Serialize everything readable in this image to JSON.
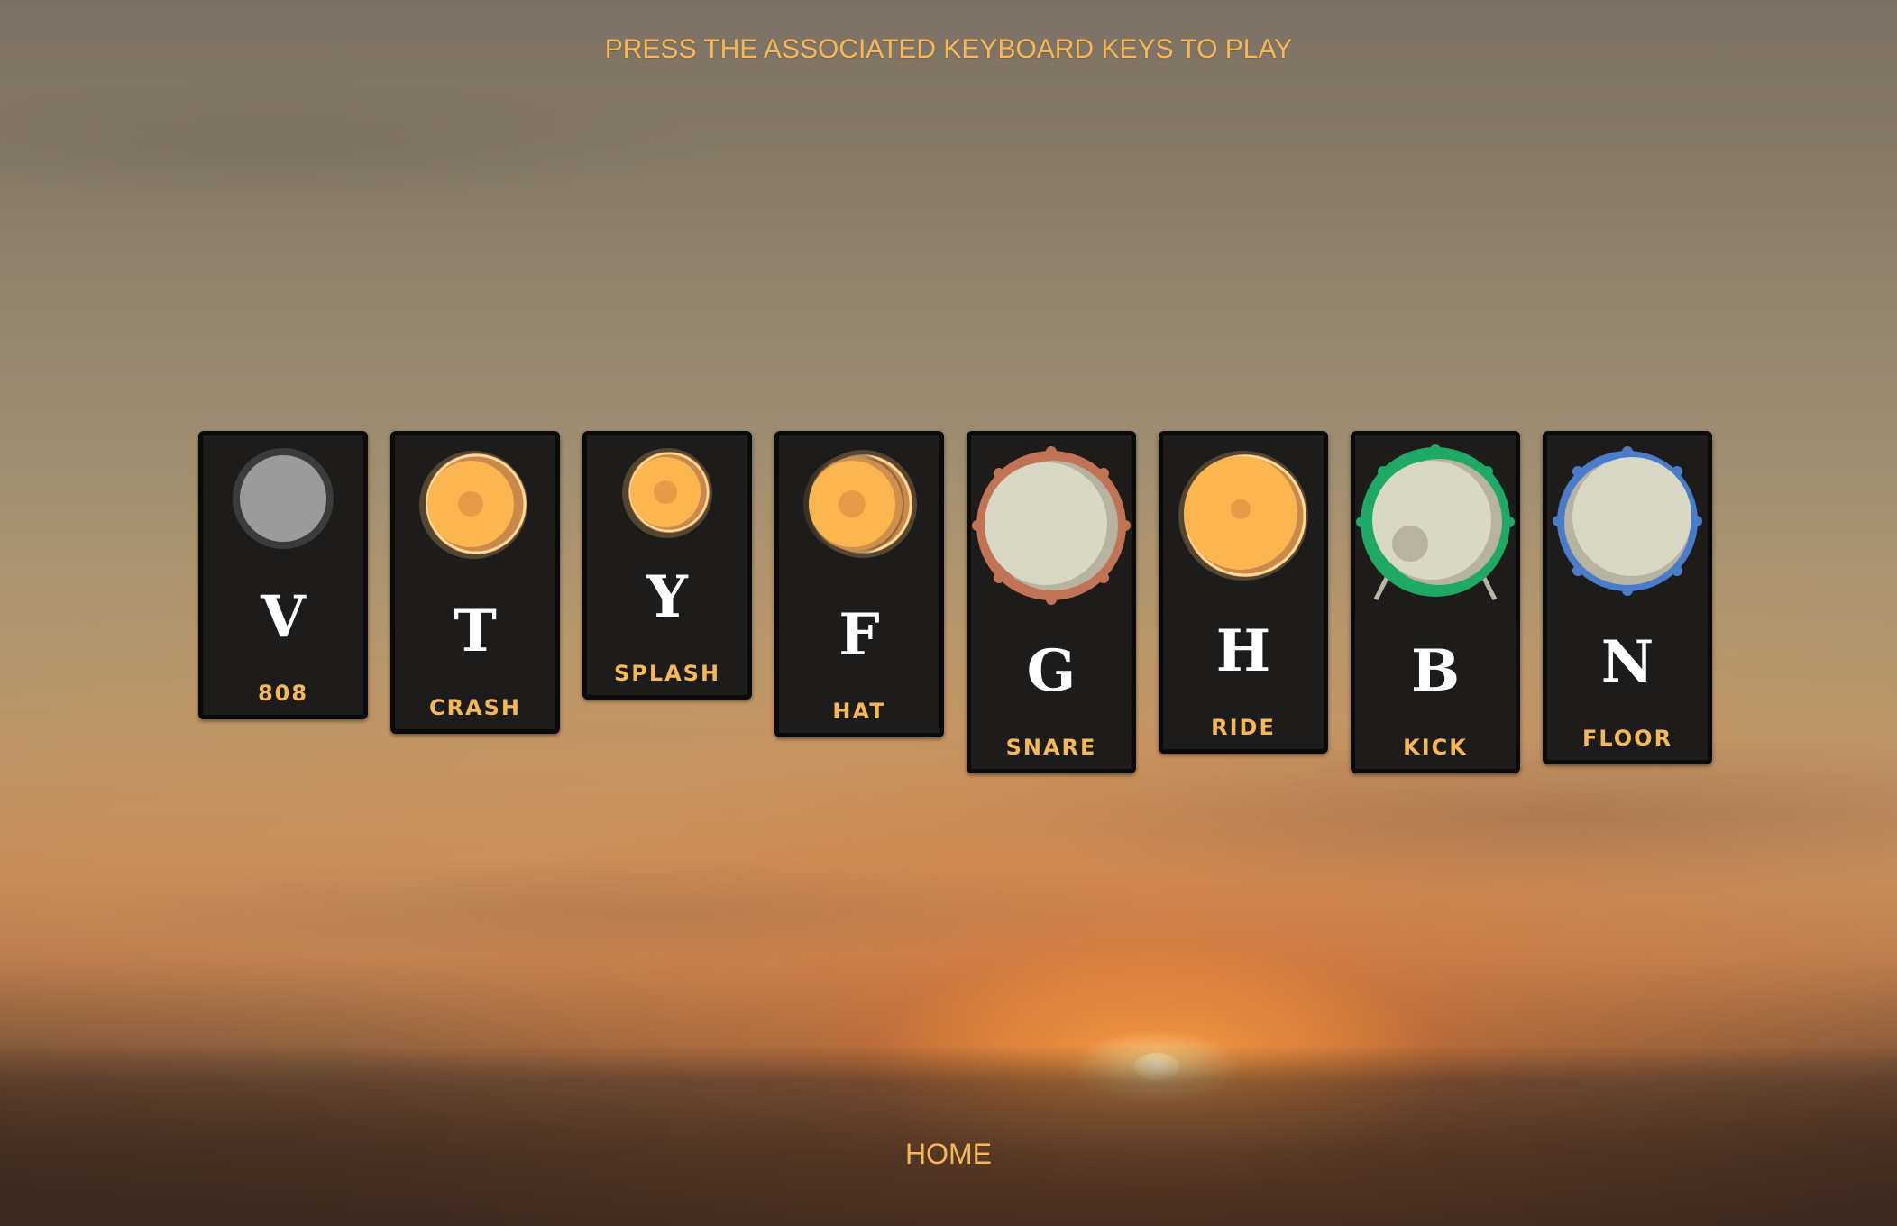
{
  "header": {
    "instructions": "PRESS THE ASSOCIATED KEYBOARD KEYS TO PLAY"
  },
  "pads": [
    {
      "key": "V",
      "label": "808",
      "icon": "808-pad-icon",
      "color": "#9b9b9b"
    },
    {
      "key": "T",
      "label": "CRASH",
      "icon": "crash-cymbal-icon",
      "color": "#fbb64f"
    },
    {
      "key": "Y",
      "label": "SPLASH",
      "icon": "splash-cymbal-icon",
      "color": "#fbb64f"
    },
    {
      "key": "F",
      "label": "HAT",
      "icon": "hi-hat-icon",
      "color": "#fbb64f"
    },
    {
      "key": "G",
      "label": "SNARE",
      "icon": "snare-drum-icon",
      "color": "#c17356"
    },
    {
      "key": "H",
      "label": "RIDE",
      "icon": "ride-cymbal-icon",
      "color": "#fbb64f"
    },
    {
      "key": "B",
      "label": "KICK",
      "icon": "kick-drum-icon",
      "color": "#1fa866"
    },
    {
      "key": "N",
      "label": "FLOOR",
      "icon": "floor-tom-icon",
      "color": "#4a7dc9"
    }
  ],
  "footer": {
    "home_label": "HOME"
  }
}
